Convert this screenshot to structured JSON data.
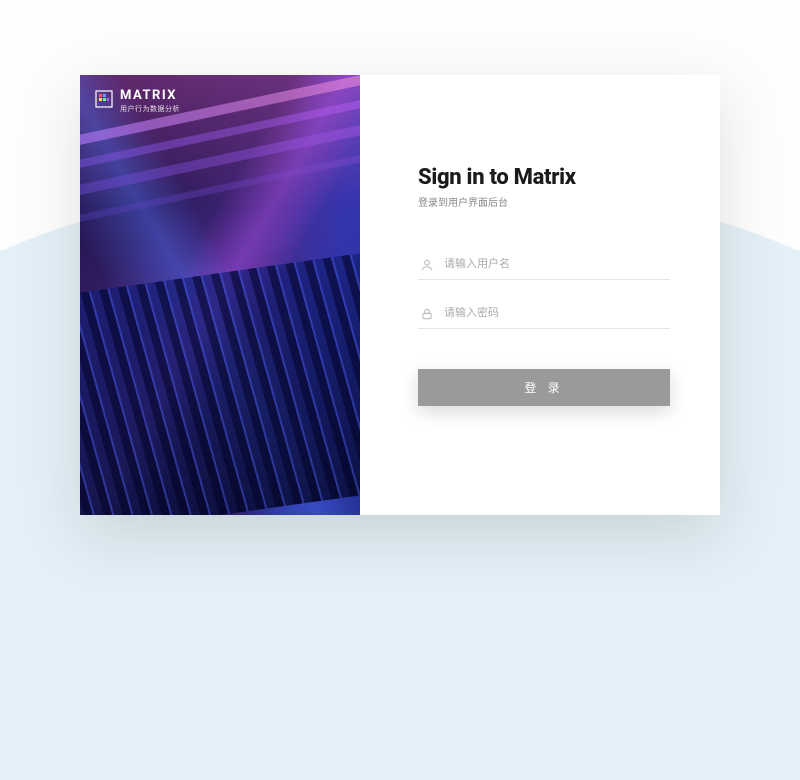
{
  "brand": {
    "name": "MATRIX",
    "tagline": "用户行为数据分析"
  },
  "login": {
    "title": "Sign in to Matrix",
    "subtitle": "登录到用户界面后台",
    "username_placeholder": "请输入用户名",
    "password_placeholder": "请输入密码",
    "submit_label": "登 录"
  },
  "colors": {
    "button": "#9a9a9a",
    "background": "#f0f6fa"
  }
}
